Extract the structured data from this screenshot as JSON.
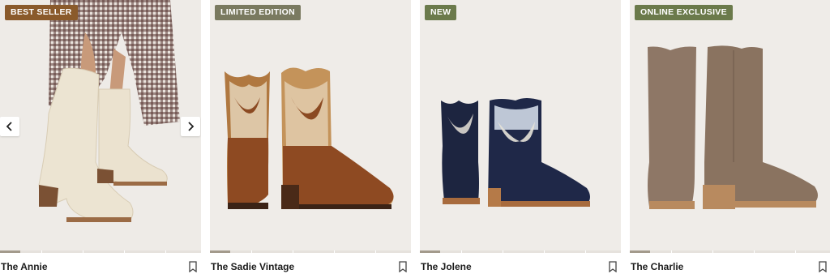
{
  "products": [
    {
      "name": "The Annie",
      "badge": "BEST SELLER",
      "badge_color": "#8a5a2b",
      "image": "model-wearing-cream-boots",
      "progress": 0.1
    },
    {
      "name": "The Sadie Vintage",
      "badge": "LIMITED EDITION",
      "badge_color": "#7a7a60",
      "image": "brown-stitched-cowboy-boots",
      "progress": 0.1
    },
    {
      "name": "The Jolene",
      "badge": "NEW",
      "badge_color": "#6b7a4b",
      "image": "navy-short-cowboy-boots",
      "progress": 0.1
    },
    {
      "name": "The Charlie",
      "badge": "ONLINE EXCLUSIVE",
      "badge_color": "#6b7a4b",
      "image": "taupe-tall-suede-boots",
      "progress": 0.1
    }
  ],
  "icons": {
    "save": "bookmark-icon",
    "prev": "chevron-left-icon",
    "next": "chevron-right-icon"
  }
}
